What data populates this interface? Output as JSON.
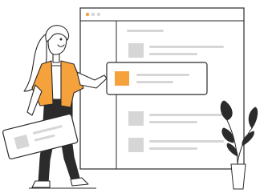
{
  "colors": {
    "accent": "#F5A13C",
    "stroke": "#2B2B2B",
    "placeholder": "#D6D6D6",
    "dots_inactive": "#D6D6D6",
    "background": "#FFFFFF"
  },
  "icons": {
    "window": "browser-window-icon",
    "list_item": "list-item-placeholder",
    "card": "highlighted-card",
    "plant": "potted-plant-icon",
    "person": "woman-holding-card-illustration"
  }
}
